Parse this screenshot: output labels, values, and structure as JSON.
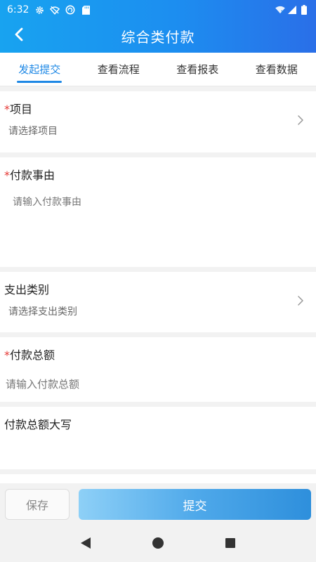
{
  "status_bar": {
    "time": "6:32",
    "left_icons": [
      "gear-icon",
      "wifi-off-icon",
      "sync-icon",
      "sd-card-icon"
    ],
    "right_icons": [
      "wifi-x-icon",
      "signal-icon",
      "battery-icon"
    ]
  },
  "header": {
    "title": "综合类付款",
    "back_icon": "chevron-left-icon",
    "color_start": "#18a3f0",
    "color_end": "#2a6fe8"
  },
  "tabs": [
    {
      "label": "发起提交",
      "active": true
    },
    {
      "label": "查看流程",
      "active": false
    },
    {
      "label": "查看报表",
      "active": false
    },
    {
      "label": "查看数据",
      "active": false
    }
  ],
  "form": {
    "project": {
      "required_mark": "*",
      "label": "项目",
      "placeholder": "请选择项目"
    },
    "reason": {
      "required_mark": "*",
      "label": "付款事由",
      "placeholder": "请输入付款事由"
    },
    "category": {
      "label": "支出类别",
      "placeholder": "请选择支出类别"
    },
    "total": {
      "required_mark": "*",
      "label": "付款总额",
      "placeholder": "请输入付款总额"
    },
    "total_upper": {
      "label": "付款总额大写"
    }
  },
  "footer": {
    "save_label": "保存",
    "submit_label": "提交"
  },
  "navbar": {
    "back_icon": "triangle-back-icon",
    "home_icon": "circle-home-icon",
    "recents_icon": "square-recents-icon"
  },
  "colors": {
    "accent": "#1e88e5",
    "required": "#e53935"
  }
}
